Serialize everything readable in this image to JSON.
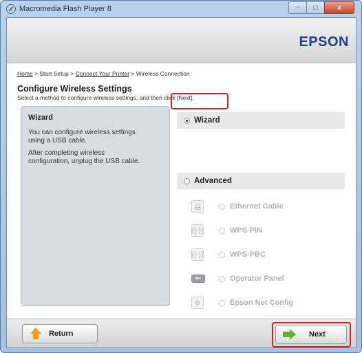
{
  "window": {
    "title": "Macromedia Flash Player 8",
    "controls": {
      "minimize": "–",
      "maximize": "□",
      "close": "x"
    }
  },
  "brand": {
    "logo": "EPSON",
    "color": "#1f3f8f"
  },
  "breadcrumb": {
    "items": [
      "Home",
      "Start Setup",
      "Connect Your Printer",
      "Wireless Connection"
    ],
    "separator": " > "
  },
  "page": {
    "title": "Configure Wireless Settings",
    "subtitle": "Select a method to configure wireless settings, and then click [Next]."
  },
  "info_panel": {
    "title": "Wizard",
    "lines": [
      "You can configure wireless settings",
      "using a USB cable.",
      "After completing wireless",
      "configuration, unplug the USB cable."
    ]
  },
  "options": {
    "wizard": {
      "label": "Wizard",
      "selected": true
    },
    "advanced": {
      "label": "Advanced",
      "selected": false
    },
    "advanced_items": [
      {
        "label": "Ethernet Cable",
        "icon": "ethernet-icon",
        "enabled": false
      },
      {
        "label": "WPS-PIN",
        "icon": "wireless-icon",
        "enabled": false
      },
      {
        "label": "WPS-PBC",
        "icon": "wireless-icon",
        "enabled": false
      },
      {
        "label": "Operator Panel",
        "icon": "operator-panel-icon",
        "enabled": false
      },
      {
        "label": "Epson Net Config",
        "icon": "network-config-icon",
        "enabled": false
      }
    ]
  },
  "footer": {
    "return_label": "Return",
    "next_label": "Next"
  },
  "colors": {
    "highlight": "#d0232a",
    "return_arrow": "#f29a1f",
    "next_arrow": "#5fb438"
  }
}
